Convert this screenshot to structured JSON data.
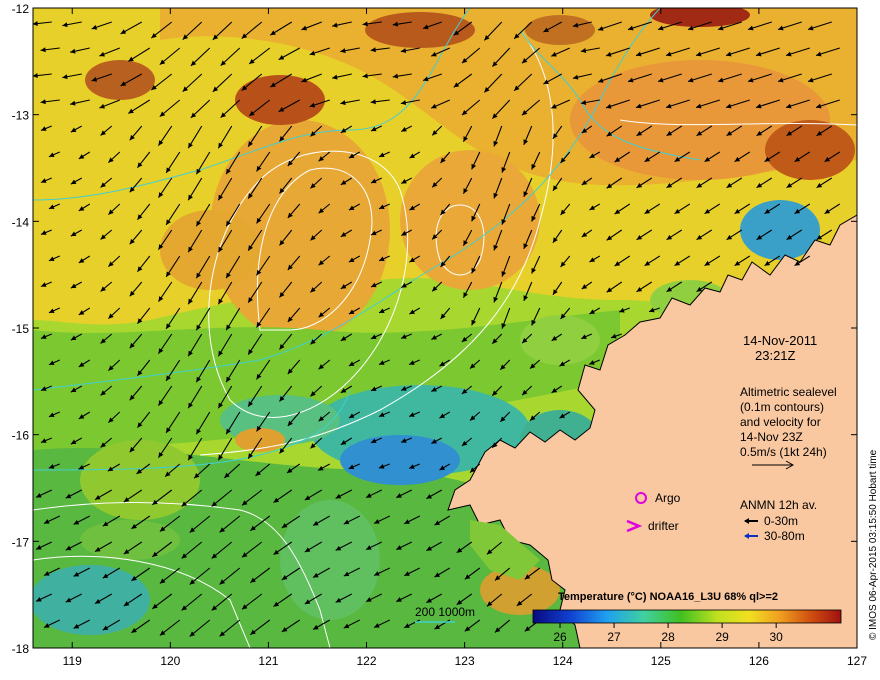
{
  "map": {
    "lon_ticks": [
      "119",
      "120",
      "121",
      "122",
      "123",
      "124",
      "125",
      "126",
      "127"
    ],
    "lat_ticks": [
      "-12",
      "-13",
      "-14",
      "-15",
      "-16",
      "-17",
      "-18"
    ],
    "lon_range": [
      118.6,
      127.0
    ],
    "lat_range": [
      -12.0,
      -18.0
    ]
  },
  "annotations": {
    "date": "14-Nov-2011",
    "time": "23:21Z",
    "alt_line1": "Altimetric sealevel",
    "alt_line2": "(0.1m contours)",
    "alt_line3": "and velocity for",
    "alt_line4": "14-Nov 23Z",
    "alt_line5": "0.5m/s (1kt 24h)",
    "argo_label": "Argo",
    "drifter_label": "drifter",
    "anmn_title": "ANMN 12h av.",
    "anmn_shallow": "0-30m",
    "anmn_deep": "30-80m",
    "isobath_label": "200  1000m"
  },
  "colorbar": {
    "title": "Temperature (°C) NOAA16_L3U 68% ql>=2",
    "ticks": [
      "26",
      "27",
      "28",
      "29",
      "30"
    ]
  },
  "credit": "© IMOS 06-Apr-2015 03:15:50 Hobart time",
  "colors": {
    "land": "#f9c8a0",
    "argo": "#e000e0",
    "drifter": "#e000e0",
    "anmn_shallow": "#000000",
    "anmn_deep": "#1030c0",
    "isobath": "#40d0d0",
    "contour": "#ffffff"
  }
}
